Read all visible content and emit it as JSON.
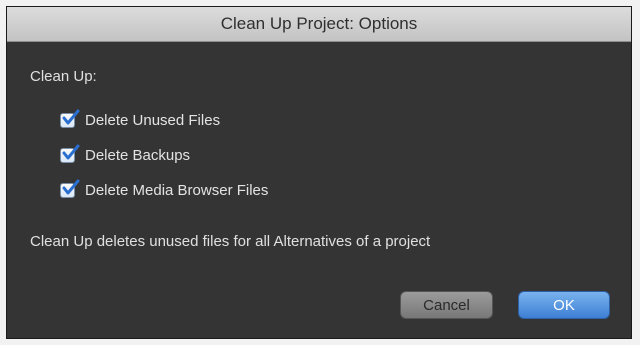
{
  "dialog": {
    "title": "Clean Up Project: Options",
    "section_label": "Clean Up:",
    "options": [
      {
        "label": "Delete Unused Files",
        "checked": true
      },
      {
        "label": "Delete Backups",
        "checked": true
      },
      {
        "label": "Delete Media Browser Files",
        "checked": true
      }
    ],
    "description": "Clean Up deletes unused files for all Alternatives of a project",
    "buttons": {
      "cancel": "Cancel",
      "ok": "OK"
    }
  },
  "colors": {
    "accent": "#3d7fd4",
    "checkmark": "#2a6fcf",
    "panel_background": "#343434"
  },
  "icons": {
    "checkbox": "checkmark-icon"
  }
}
